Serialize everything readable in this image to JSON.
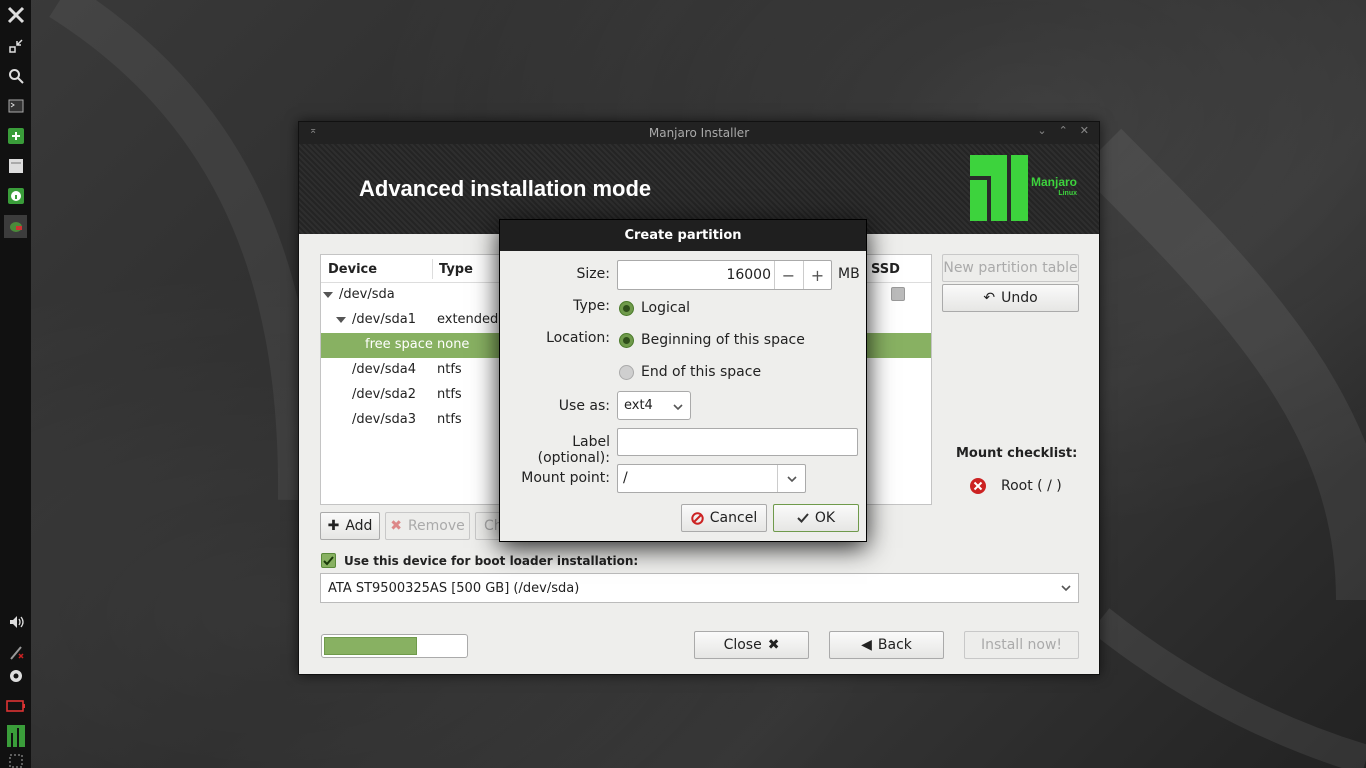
{
  "window": {
    "title": "Manjaro Installer",
    "heading": "Advanced installation mode",
    "logo_text": "Manjaro",
    "logo_sub": "Linux"
  },
  "partition_table": {
    "columns": [
      "Device",
      "Type",
      "SSD"
    ],
    "rows": [
      {
        "device": "/dev/sda",
        "type": ""
      },
      {
        "device": "/dev/sda1",
        "type": "extended"
      },
      {
        "device": "free space",
        "type": "none"
      },
      {
        "device": "/dev/sda4",
        "type": "ntfs"
      },
      {
        "device": "/dev/sda2",
        "type": "ntfs"
      },
      {
        "device": "/dev/sda3",
        "type": "ntfs"
      }
    ],
    "selected_row": 2
  },
  "buttons": {
    "add": "Add",
    "remove": "Remove",
    "change": "Ch",
    "new_partition_table": "New partition table",
    "undo": "Undo",
    "close": "Close",
    "back": "Back",
    "install_now": "Install now!"
  },
  "mount_checklist": {
    "title": "Mount checklist:",
    "items": [
      {
        "label": "Root ( / )",
        "status": "missing"
      }
    ]
  },
  "bootloader": {
    "label": "Use this device for boot loader installation:",
    "checked": true,
    "device": "ATA ST9500325AS [500 GB] (/dev/sda)"
  },
  "progress": {
    "fraction": 0.66
  },
  "dialog": {
    "title": "Create partition",
    "size_label": "Size:",
    "size_value": "16000",
    "size_unit": "MB",
    "type_label": "Type:",
    "type_option": "Logical",
    "location_label": "Location:",
    "location_options": [
      "Beginning of this space",
      "End of this space"
    ],
    "location_selected": 0,
    "use_as_label": "Use as:",
    "use_as_value": "ext4",
    "label_label": "Label (optional):",
    "label_value": "",
    "mount_label": "Mount point:",
    "mount_value": "/",
    "cancel": "Cancel",
    "ok": "OK"
  },
  "colors": {
    "accent": "#88b162",
    "brand": "#3dd33d",
    "error": "#cc2222"
  }
}
